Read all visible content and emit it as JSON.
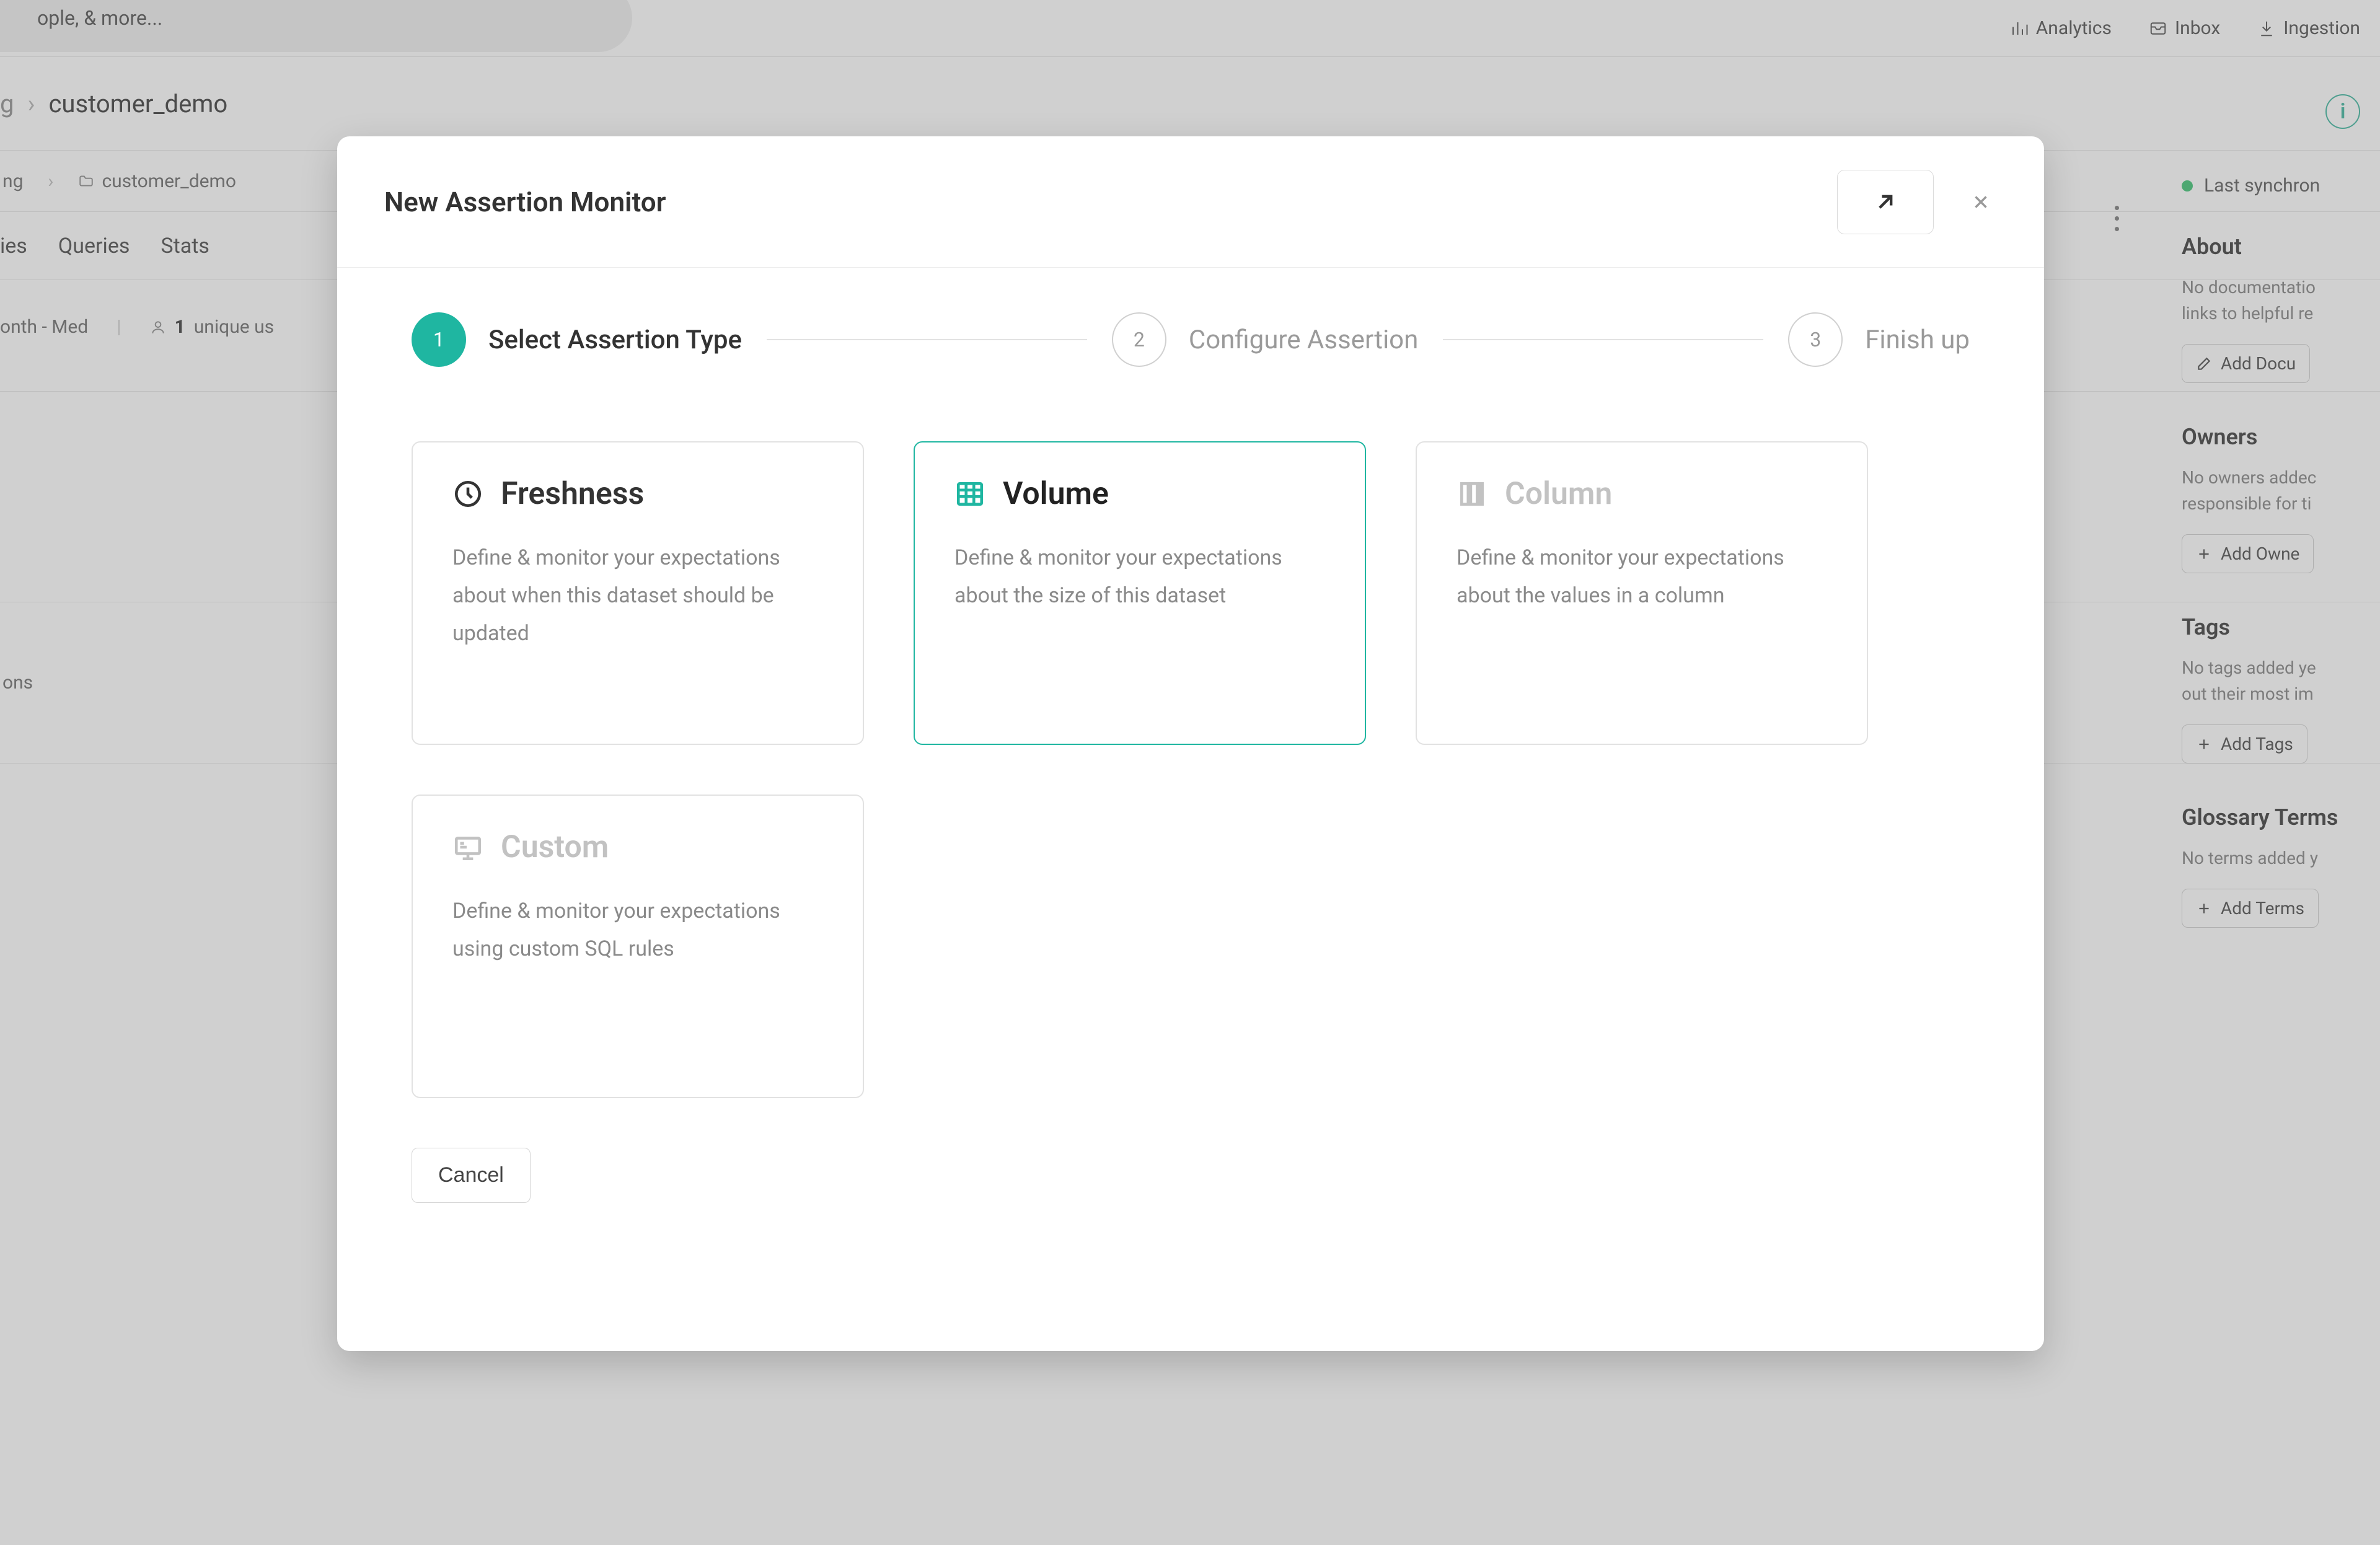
{
  "bg": {
    "search_placeholder": "ople, & more...",
    "top_nav": {
      "analytics": "Analytics",
      "inbox": "Inbox",
      "ingestion": "Ingestion"
    },
    "breadcrumb": {
      "partial": "g",
      "current": "customer_demo"
    },
    "second_row": {
      "partial_left": "ng",
      "folder": "customer_demo",
      "cadence": "onth - Med",
      "unique_users": "1",
      "unique_users_label": "unique us"
    },
    "tabs": {
      "t1": "ies",
      "t2": "Queries",
      "t3": "Stats"
    },
    "left_partial": "ons",
    "status": "Last synchron",
    "about": {
      "title": "About",
      "text": "No documentatio\nlinks to helpful re",
      "button": "Add Docu"
    },
    "owners": {
      "title": "Owners",
      "text": "No owners addec\nresponsible for ti",
      "button": "Add Owne"
    },
    "tags": {
      "title": "Tags",
      "text": "No tags added ye\nout their most im",
      "button": "Add Tags"
    },
    "glossary": {
      "title": "Glossary Terms",
      "text": "No terms added y",
      "button": "Add Terms"
    }
  },
  "modal": {
    "title": "New Assertion Monitor",
    "steps": [
      {
        "num": "1",
        "label": "Select Assertion Type"
      },
      {
        "num": "2",
        "label": "Configure Assertion"
      },
      {
        "num": "3",
        "label": "Finish up"
      }
    ],
    "cards": {
      "freshness": {
        "title": "Freshness",
        "desc": "Define & monitor your expectations about when this dataset should be updated"
      },
      "volume": {
        "title": "Volume",
        "desc": "Define & monitor your expectations about the size of this dataset"
      },
      "column": {
        "title": "Column",
        "desc": "Define & monitor your expectations about the values in a column"
      },
      "custom": {
        "title": "Custom",
        "desc": "Define & monitor your expectations using custom SQL rules"
      }
    },
    "cancel": "Cancel"
  }
}
